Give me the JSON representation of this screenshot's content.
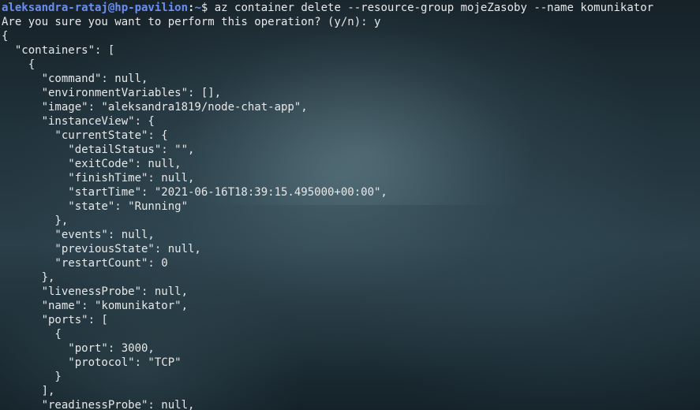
{
  "prompt": {
    "user_host": "aleksandra-rataj@hp-pavilion",
    "separator": ":",
    "path": "~",
    "symbol": "$ ",
    "command": "az container delete --resource-group mojeZasoby --name komunikator"
  },
  "output_lines": [
    "Are you sure you want to perform this operation? (y/n): y",
    "{",
    "  \"containers\": [",
    "    {",
    "      \"command\": null,",
    "      \"environmentVariables\": [],",
    "      \"image\": \"aleksandra1819/node-chat-app\",",
    "      \"instanceView\": {",
    "        \"currentState\": {",
    "          \"detailStatus\": \"\",",
    "          \"exitCode\": null,",
    "          \"finishTime\": null,",
    "          \"startTime\": \"2021-06-16T18:39:15.495000+00:00\",",
    "          \"state\": \"Running\"",
    "        },",
    "        \"events\": null,",
    "        \"previousState\": null,",
    "        \"restartCount\": 0",
    "      },",
    "      \"livenessProbe\": null,",
    "      \"name\": \"komunikator\",",
    "      \"ports\": [",
    "        {",
    "          \"port\": 3000,",
    "          \"protocol\": \"TCP\"",
    "        }",
    "      ],",
    "      \"readinessProbe\": null,"
  ]
}
